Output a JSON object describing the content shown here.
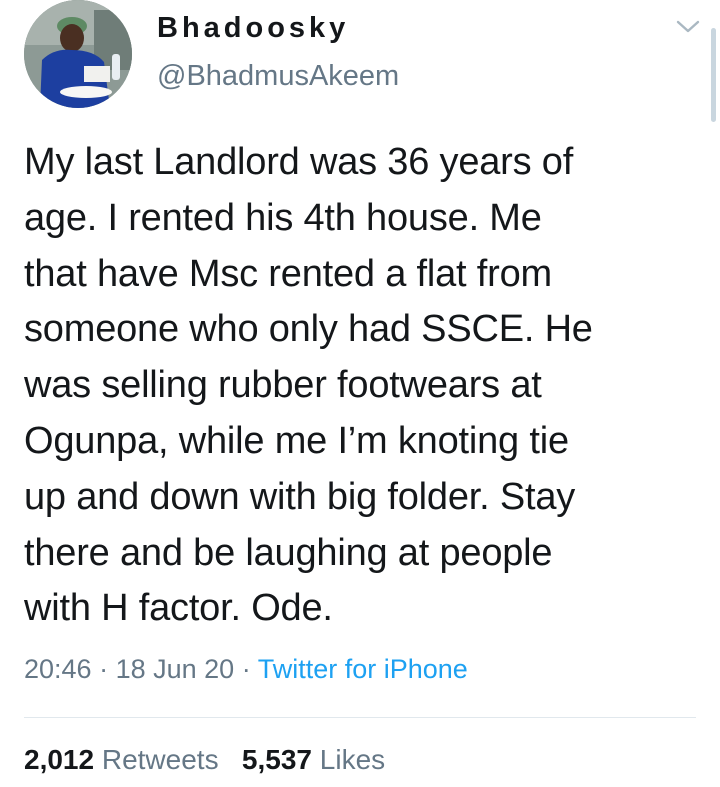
{
  "user": {
    "display_name": "Bhadoosky",
    "handle": "@BhadmusAkeem"
  },
  "tweet": {
    "lines": [
      "My last Landlord was 36 years of",
      "age. I rented his 4th house. Me",
      "that have Msc rented a flat from",
      "someone who only had SSCE. He",
      "was selling rubber footwears at",
      "Ogunpa, while me I’m knoting tie",
      "up and down with big folder. Stay",
      "there and be laughing at people",
      "with H factor. Ode."
    ]
  },
  "meta": {
    "time": "20:46",
    "separator": " · ",
    "date": "18 Jun 20",
    "source": "Twitter for iPhone"
  },
  "stats": {
    "retweets_count": "2,012",
    "retweets_label": "Retweets",
    "likes_count": "5,537",
    "likes_label": "Likes"
  },
  "colors": {
    "text": "#14171a",
    "secondary": "#657786",
    "link": "#1da1f2",
    "divider": "#e1e8ed"
  },
  "icons": {
    "caret": "chevron-down-icon"
  }
}
